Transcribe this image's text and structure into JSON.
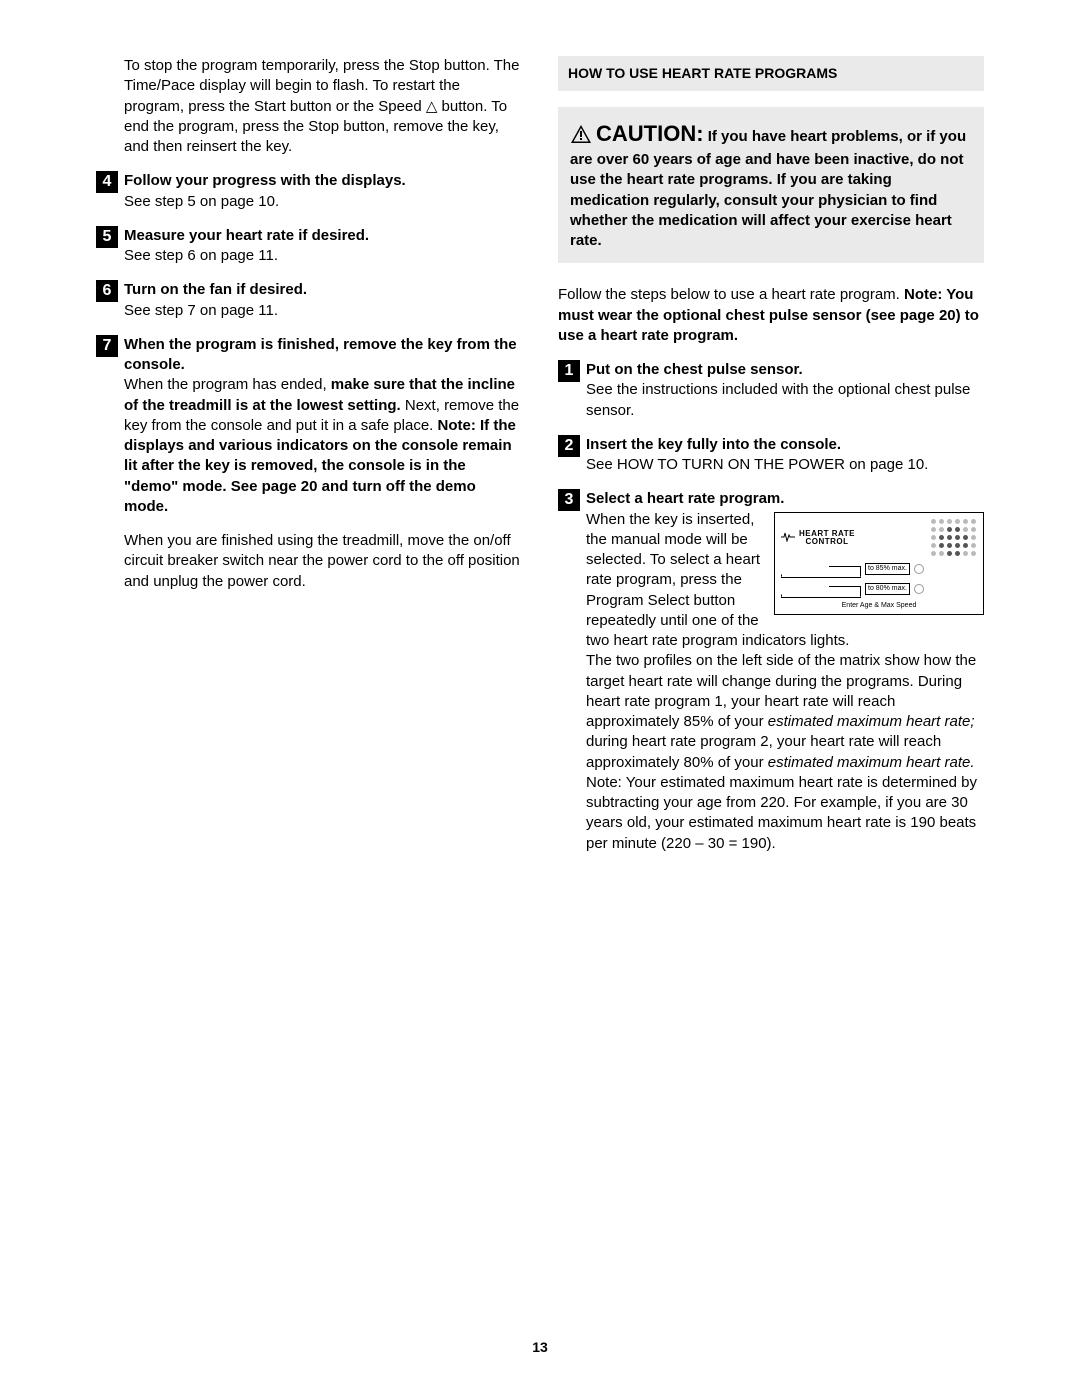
{
  "page_number": "13",
  "left": {
    "intro": "To stop the program temporarily, press the Stop button. The Time/Pace display will begin to flash. To restart the program, press the Start button or the Speed △ button. To end the program, press the Stop button, remove the key, and then reinsert the key.",
    "steps": [
      {
        "num": "4",
        "title": "Follow your progress with the displays.",
        "body": "See step 5 on page 10."
      },
      {
        "num": "5",
        "title": "Measure your heart rate if desired.",
        "body": "See step 6 on page 11."
      },
      {
        "num": "6",
        "title": "Turn on the fan if desired.",
        "body": "See step 7 on page 11."
      },
      {
        "num": "7",
        "title": "When the program is finished, remove the key from the console.",
        "para1_a": "When the program has ended, ",
        "para1_b_bold": "make sure that the incline of the treadmill is at the lowest setting.",
        "para1_c": " Next, remove the key from the console and put it in a safe place. ",
        "para1_d_bold": "Note: If the displays and various indicators on the console remain lit after the key is removed, the console is in the \"demo\" mode. See page 20 and turn off the demo mode.",
        "para2": "When you are finished using the treadmill, move the on/off circuit breaker switch near the power cord to the off position and unplug the power cord."
      }
    ]
  },
  "right": {
    "section_title": "HOW TO USE HEART RATE PROGRAMS",
    "caution_word": "CAUTION:",
    "caution_body": "If you have heart problems, or if you are over 60 years of age and have been inactive, do not use the heart rate programs. If you are taking medication regularly, consult your physician to find whether the medication will affect your exercise heart rate.",
    "intro_a": "Follow the steps below to use a heart rate program. ",
    "intro_b_bold": "Note: You must wear the optional chest pulse sensor (see page 20) to use a heart rate program.",
    "steps": [
      {
        "num": "1",
        "title": "Put on the chest pulse sensor.",
        "body": "See the instructions included with the optional chest pulse sensor."
      },
      {
        "num": "2",
        "title": "Insert the key fully into the console.",
        "body": "See HOW TO TURN ON THE POWER on page 10."
      },
      {
        "num": "3",
        "title": "Select a heart rate program.",
        "wrap_text": "When the key is inserted, the manual mode will be selected. To select a heart rate program,",
        "after_wrap": " press the Program Select button repeatedly until one of the two heart rate program indicators lights.",
        "diagram": {
          "title1": "HEART RATE",
          "title2": "CONTROL",
          "row1_label": "to 85% max.",
          "row2_label": "to 80% max.",
          "footer": "Enter Age & Max Speed"
        },
        "para2_a": "The two profiles on the left side of the matrix show how the target heart rate will change during the programs. During heart rate program 1, your heart rate will reach approximately 85% of your ",
        "para2_b_i": "estimated maximum heart rate;",
        "para2_c": " during heart rate program 2, your heart rate will reach approximately 80% of your ",
        "para2_d_i": "estimated maximum heart rate.",
        "para2_e": " Note: Your estimated maximum heart rate is determined by subtracting your age from 220. For example, if you are 30 years old, your estimated maximum heart rate is 190 beats per minute (220 – 30 = 190)."
      }
    ]
  }
}
